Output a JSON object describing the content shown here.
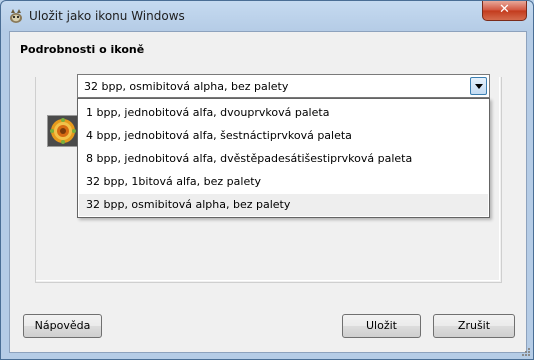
{
  "window": {
    "title": "Uložit jako ikonu Windows",
    "close_label": "✕"
  },
  "section": {
    "title": "Podrobnosti o ikoně"
  },
  "format_select": {
    "value": "32 bpp, osmibitová alpha, bez palety",
    "options": [
      "1 bpp, jednobitová alfa, dvouprvková paleta",
      "4 bpp, jednobitová alfa, šestnáctiprvková paleta",
      "8 bpp, jednobitová alfa, dvěstěpadesátišestiprvková paleta",
      "32 bpp, 1bitová alfa, bez palety",
      "32 bpp, osmibitová alpha, bez palety"
    ],
    "selected_index": 4
  },
  "buttons": {
    "help_label": "Nápověda",
    "save_label": "Uložit",
    "cancel_label": "Zrušit"
  },
  "colors": {
    "titlebar": "#c5daf0",
    "close_button": "#c23a1c",
    "selected_option_bg": "#eeeeee"
  },
  "icons": {
    "app": "gimp-wilber-icon",
    "preview": "orange-flower-icon-preview"
  }
}
